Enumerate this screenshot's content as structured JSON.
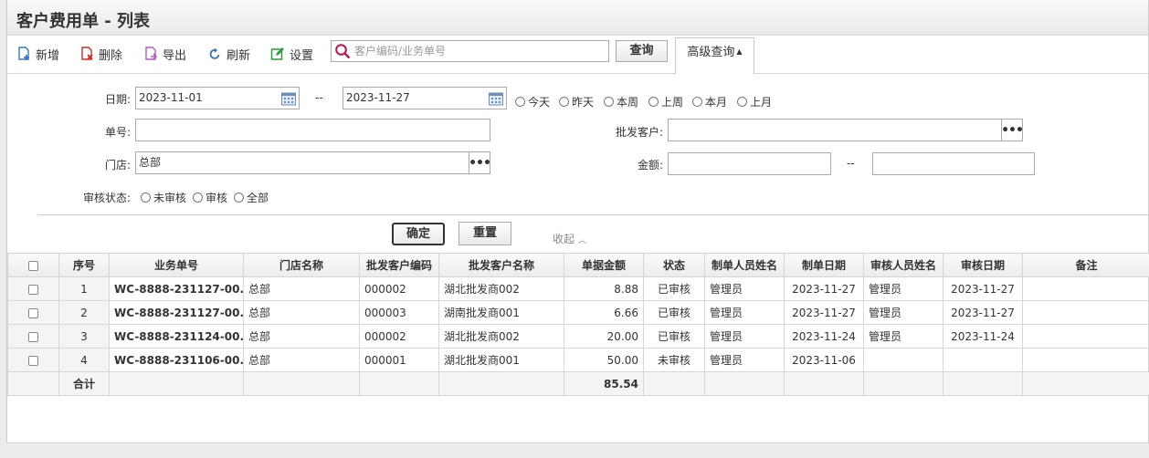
{
  "title": "客户费用单 - 列表",
  "toolbar": {
    "add": "新增",
    "delete": "删除",
    "export": "导出",
    "refresh": "刷新",
    "settings": "设置",
    "search_placeholder": "客户编码/业务单号",
    "query": "查询",
    "advanced_query": "高级查询"
  },
  "filters": {
    "date_label": "日期:",
    "date_from": "2023-11-01",
    "date_sep": "--",
    "date_to": "2023-11-27",
    "date_options": [
      "今天",
      "昨天",
      "本周",
      "上周",
      "本月",
      "上月"
    ],
    "order_no_label": "单号:",
    "order_no_value": "",
    "wholesale_customer_label": "批发客户:",
    "wholesale_customer_value": "",
    "store_label": "门店:",
    "store_value": "总部",
    "amount_label": "金额:",
    "amount_sep": "--",
    "audit_status_label": "审核状态:",
    "audit_options": [
      "未审核",
      "审核",
      "全部"
    ],
    "confirm": "确定",
    "reset": "重置",
    "collapse": "收起"
  },
  "table": {
    "headers": [
      "序号",
      "业务单号",
      "门店名称",
      "批发客户编码",
      "批发客户名称",
      "单据金额",
      "状态",
      "制单人员姓名",
      "制单日期",
      "审核人员姓名",
      "审核日期",
      "备注"
    ],
    "rows": [
      {
        "no": "1",
        "order": "WC-8888-231127-00...",
        "store": "总部",
        "code": "000002",
        "name": "湖北批发商002",
        "amount": "8.88",
        "status": "已审核",
        "creator": "管理员",
        "created": "2023-11-27",
        "auditor": "管理员",
        "audited": "2023-11-27",
        "remark": ""
      },
      {
        "no": "2",
        "order": "WC-8888-231127-00...",
        "store": "总部",
        "code": "000003",
        "name": "湖南批发商001",
        "amount": "6.66",
        "status": "已审核",
        "creator": "管理员",
        "created": "2023-11-27",
        "auditor": "管理员",
        "audited": "2023-11-27",
        "remark": ""
      },
      {
        "no": "3",
        "order": "WC-8888-231124-00...",
        "store": "总部",
        "code": "000002",
        "name": "湖北批发商002",
        "amount": "20.00",
        "status": "已审核",
        "creator": "管理员",
        "created": "2023-11-24",
        "auditor": "管理员",
        "audited": "2023-11-24",
        "remark": ""
      },
      {
        "no": "4",
        "order": "WC-8888-231106-00...",
        "store": "总部",
        "code": "000001",
        "name": "湖北批发商001",
        "amount": "50.00",
        "status": "未审核",
        "creator": "管理员",
        "created": "2023-11-06",
        "auditor": "",
        "audited": "",
        "remark": ""
      }
    ],
    "total_label": "合计",
    "total_amount": "85.54"
  }
}
